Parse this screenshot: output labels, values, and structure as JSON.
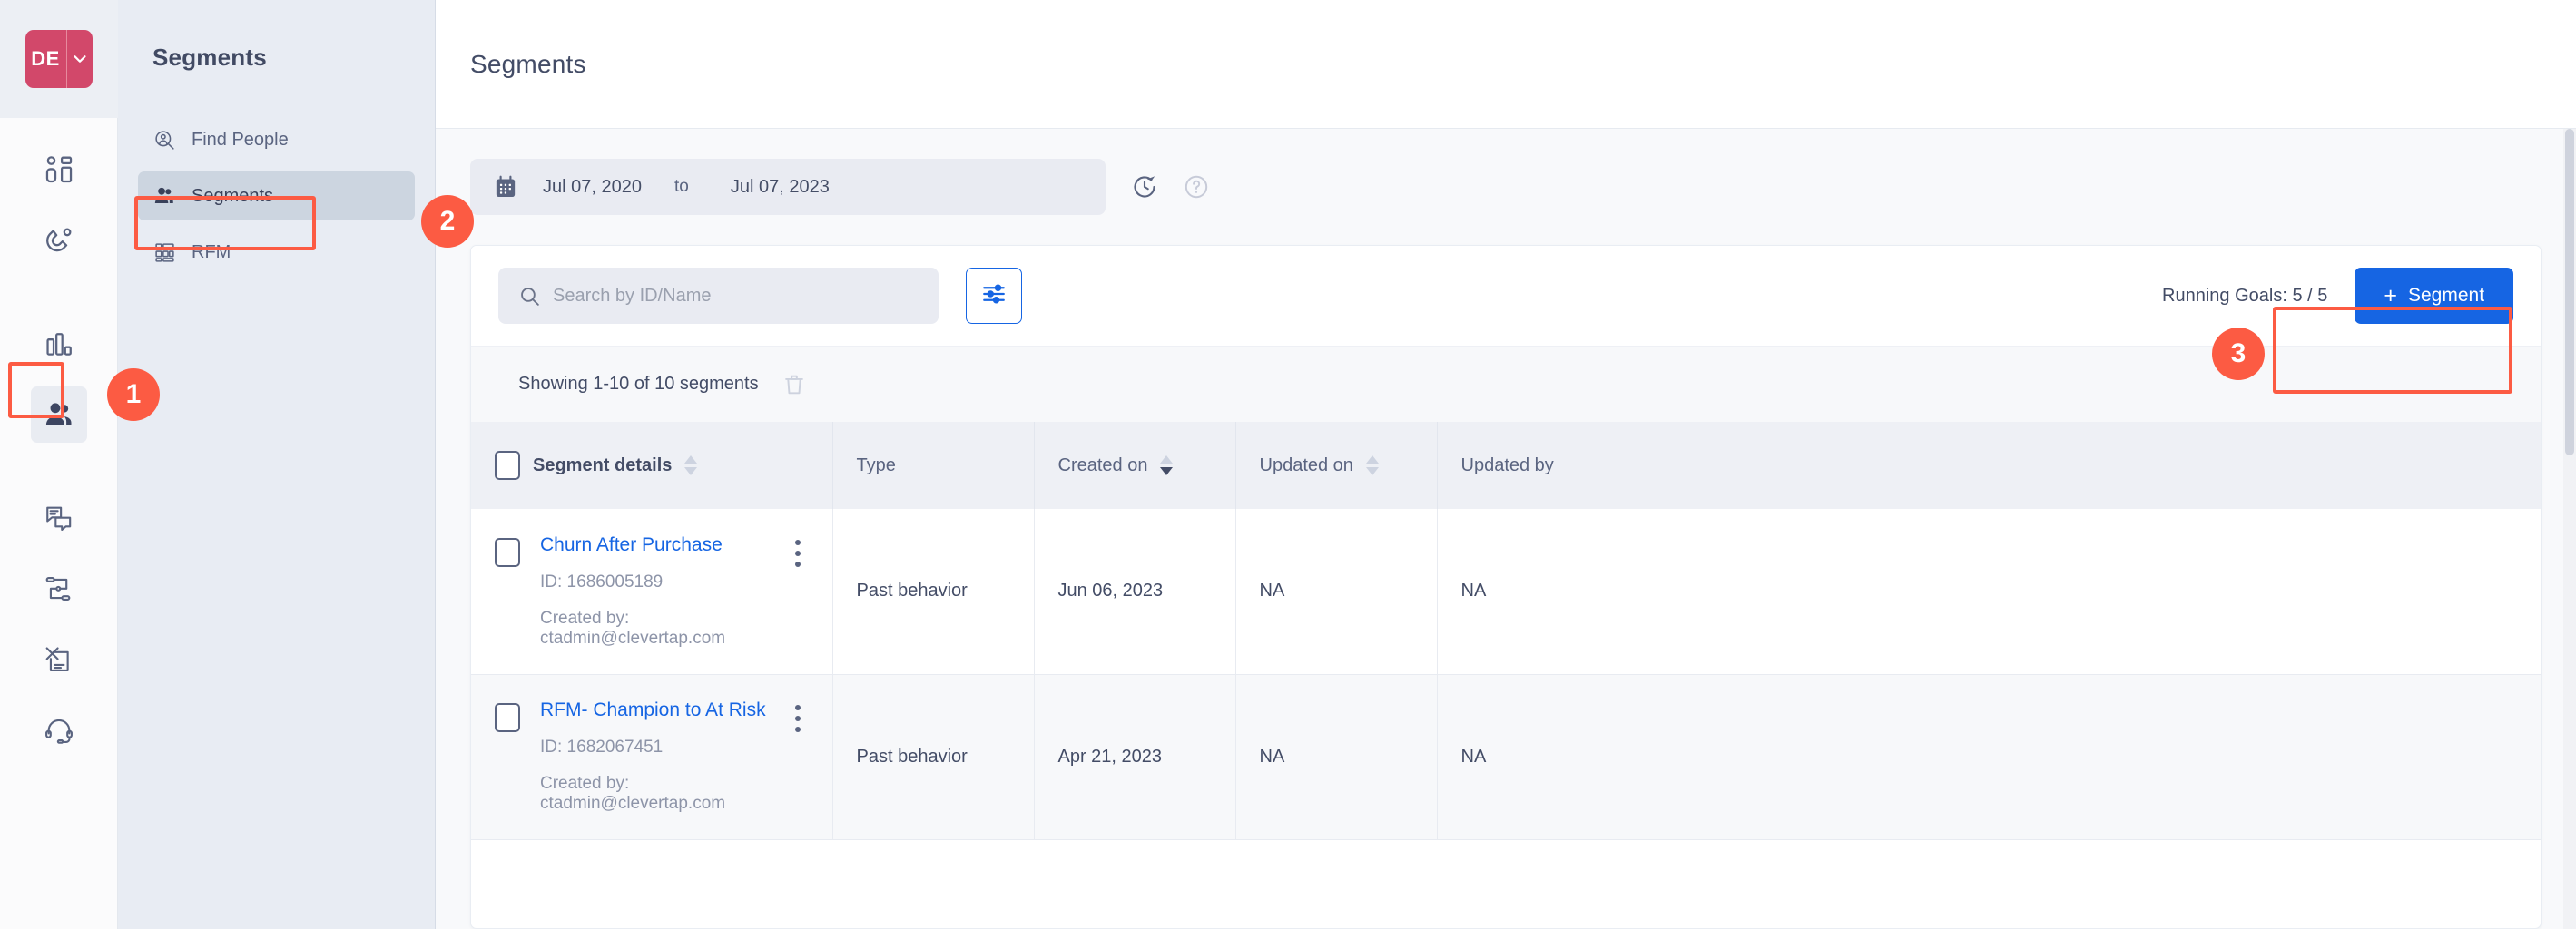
{
  "brand": {
    "code": "DE",
    "caret_icon": "chevron-down-icon"
  },
  "rail": {
    "items": [
      {
        "name": "dashboard",
        "icon": "dashboard-blocks-icon",
        "active": false
      },
      {
        "name": "engage",
        "icon": "magnet-icon",
        "active": false
      },
      {
        "name": "analytics",
        "icon": "bar-chart-icon",
        "active": false
      },
      {
        "name": "audience",
        "icon": "people-icon",
        "active": true
      },
      {
        "name": "messages",
        "icon": "chat-bubbles-icon",
        "active": false
      },
      {
        "name": "journeys",
        "icon": "flow-nodes-icon",
        "active": false
      },
      {
        "name": "campaigns",
        "icon": "send-document-icon",
        "active": false
      },
      {
        "name": "support",
        "icon": "headset-icon",
        "active": false
      }
    ]
  },
  "sidebar": {
    "title": "Segments",
    "items": [
      {
        "label": "Find People",
        "icon": "person-search-icon",
        "active": false
      },
      {
        "label": "Segments",
        "icon": "people-icon",
        "active": true
      },
      {
        "label": "RFM",
        "icon": "grid-blocks-icon",
        "active": false
      }
    ]
  },
  "header": {
    "title": "Segments"
  },
  "daterange": {
    "calendar_icon": "calendar-icon",
    "start": "Jul 07, 2020",
    "separator": "to",
    "end": "Jul 07, 2023",
    "refresh_icon": "clock-refresh-icon",
    "help_icon": "help-circle-icon"
  },
  "search": {
    "icon": "search-icon",
    "value": "",
    "placeholder": "Search by ID/Name"
  },
  "filter": {
    "icon": "filter-sliders-icon"
  },
  "running_goals": "Running Goals: 5 / 5",
  "segment_button": {
    "plus": "+",
    "label": "Segment"
  },
  "showing": {
    "text": "Showing 1-10 of 10 segments",
    "delete_icon": "trash-icon"
  },
  "table": {
    "columns": [
      {
        "key": "segment_details",
        "label": "Segment details",
        "sortable": true,
        "sort": "none",
        "bold": true
      },
      {
        "key": "type",
        "label": "Type",
        "sortable": false,
        "sort": "none",
        "bold": false
      },
      {
        "key": "created_on",
        "label": "Created on",
        "sortable": true,
        "sort": "desc",
        "bold": false
      },
      {
        "key": "updated_on",
        "label": "Updated on",
        "sortable": true,
        "sort": "none",
        "bold": false
      },
      {
        "key": "updated_by",
        "label": "Updated by",
        "sortable": false,
        "sort": "none",
        "bold": false
      }
    ],
    "rows": [
      {
        "name": "Churn After Purchase",
        "id_label": "ID: 1686005189",
        "created_by_label": "Created by: ctadmin@clevertap.com",
        "type": "Past behavior",
        "created_on": "Jun 06, 2023",
        "updated_on": "NA",
        "updated_by": "NA",
        "kebab_icon": "more-vertical-icon"
      },
      {
        "name": "RFM- Champion to At Risk",
        "id_label": "ID: 1682067451",
        "created_by_label": "Created by: ctadmin@clevertap.com",
        "type": "Past behavior",
        "created_on": "Apr 21, 2023",
        "updated_on": "NA",
        "updated_by": "NA",
        "kebab_icon": "more-vertical-icon"
      }
    ]
  },
  "annotations": [
    {
      "number": "1",
      "target": "audience-rail-icon"
    },
    {
      "number": "2",
      "target": "sidebar-item-segments"
    },
    {
      "number": "3",
      "target": "add-segment-button"
    }
  ],
  "colors": {
    "accent_blue": "#1665e3",
    "brand_pink": "#d2486a",
    "annotation_red": "#fc5b43",
    "sidebar_bg": "#e8ecf3",
    "text_dark": "#434c66",
    "text_muted": "#8d94a8"
  }
}
